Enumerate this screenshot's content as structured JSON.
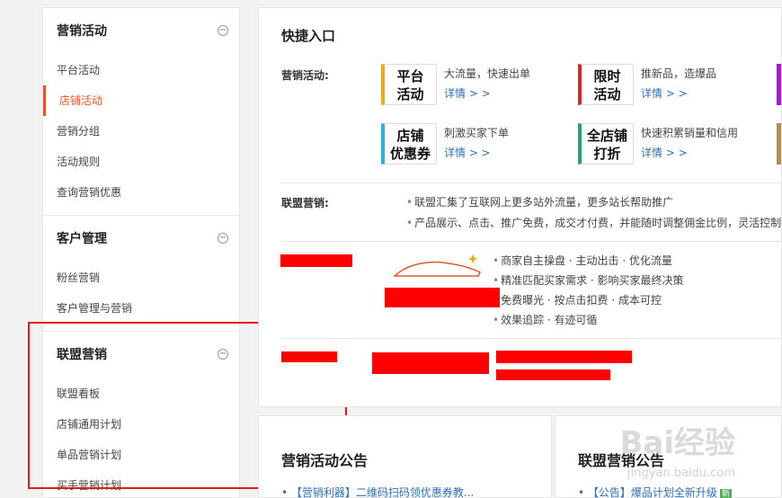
{
  "sidebar": {
    "groups": [
      {
        "title": "营销活动",
        "items": [
          "平台活动",
          "店铺活动",
          "营销分组",
          "活动规则",
          "查询营销优惠"
        ]
      },
      {
        "title": "客户管理",
        "items": [
          "粉丝营销",
          "客户管理与营销"
        ]
      },
      {
        "title": "联盟营销",
        "items": [
          "联盟看板",
          "店铺通用计划",
          "单品营销计划",
          "买手营销计划"
        ]
      }
    ],
    "active_item": "店铺活动",
    "collapse_symbol": "−"
  },
  "main": {
    "title": "快捷入口",
    "marketing_label": "营销活动:",
    "quick": [
      {
        "tile": "平台\n活动",
        "desc": "大流量，快速出单",
        "more": "详情 > >",
        "color": "#f0a81c"
      },
      {
        "tile": "限时\n活动",
        "desc": "推新品，造爆品",
        "more": "详情 > >",
        "color": "#d9262b"
      },
      {
        "tile": "店铺\n优惠券",
        "desc": "刺激买家下单",
        "more": "详情 > >",
        "color": "#2ab3d6"
      },
      {
        "tile": "全店铺\n打折",
        "desc": "快速积累销量和信用",
        "more": "详情 > >",
        "color": "#21a67a"
      }
    ],
    "stub_colors": [
      "#a020c8",
      "#b08d5c"
    ],
    "alliance_label": "联盟营销:",
    "alliance_points": [
      "联盟汇集了互联网上更多站外流量，更多站长帮助推广",
      "产品展示、点击、推广免费，成交才付费，并能随时调整佣金比例，灵活控制"
    ],
    "promo_points": [
      "商家自主操盘 · 主动出击 · 优化流量",
      "精准匹配买家需求 · 影响买家最终决策",
      "免费曝光 · 按点击扣费 · 成本可控",
      "效果追踪 · 有迹可循"
    ]
  },
  "bottom": {
    "left_title": "营销活动公告",
    "left_link_tag": "【营销利器】",
    "left_link_text": "二维码扫码领优惠券教...",
    "right_title": "联盟营销公告",
    "right_link_tag": "【公告】",
    "right_link_text": "爆品计划全新升级",
    "right_badge": "新"
  },
  "watermark": {
    "main": "Bai经验",
    "sub": "jingyan.baidu.com"
  },
  "colors": {
    "accent": "#e4572e",
    "link": "#2f6fb3",
    "annotation": "#e21a1a",
    "redaction": "#ff0000"
  }
}
